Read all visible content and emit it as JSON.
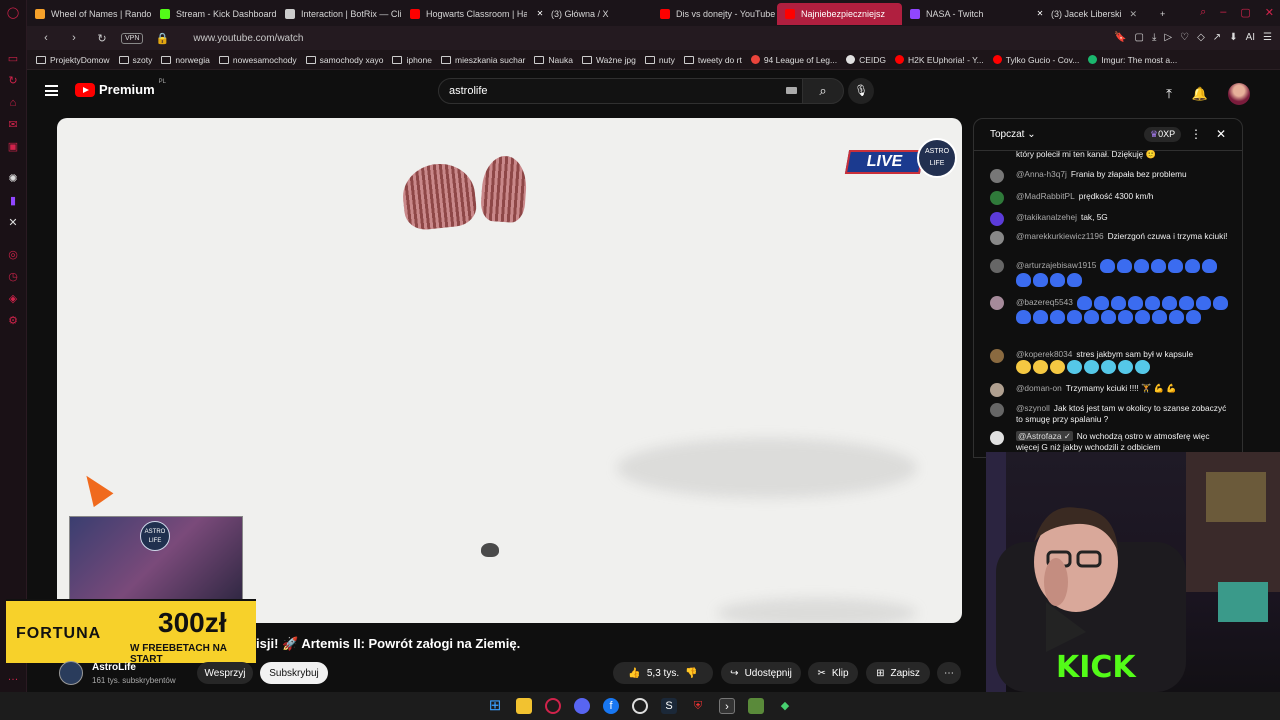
{
  "browser": {
    "tabs": [
      {
        "label": "Wheel of Names | Random",
        "color": "#f6a12a"
      },
      {
        "label": "Stream - Kick Dashboard",
        "color": "#53fc18"
      },
      {
        "label": "Interaction | BotRix — Cli",
        "color": "#cccccc"
      },
      {
        "label": "Hogwarts Classroom | Ha",
        "color": "#ff0000"
      },
      {
        "label": "(3) Główna / X",
        "color": "#ffffff"
      },
      {
        "label": "Dis vs donejty - YouTube",
        "color": "#ff0000"
      },
      {
        "label": "Najniebezpieczniejsz",
        "color": "#ff0000",
        "active": true
      },
      {
        "label": "NASA - Twitch",
        "color": "#9146ff"
      },
      {
        "label": "(3) Jacek Liberski",
        "color": "#ffffff"
      }
    ],
    "new_tab": "+",
    "window_controls": [
      "–",
      "▢",
      "✕"
    ],
    "vpn": "VPN",
    "url": "www.youtube.com/watch",
    "ai_label": "AI",
    "bookmarks": [
      {
        "label": "ProjektyDomow",
        "type": "folder"
      },
      {
        "label": "szoty",
        "type": "folder"
      },
      {
        "label": "norwegia",
        "type": "folder"
      },
      {
        "label": "nowesamochody",
        "type": "folder"
      },
      {
        "label": "samochody xayo",
        "type": "folder"
      },
      {
        "label": "iphone",
        "type": "folder"
      },
      {
        "label": "mieszkania suchar",
        "type": "folder"
      },
      {
        "label": "Nauka",
        "type": "folder"
      },
      {
        "label": "Ważne jpg",
        "type": "folder"
      },
      {
        "label": "nuty",
        "type": "folder"
      },
      {
        "label": "tweety do rt",
        "type": "folder"
      },
      {
        "label": "94 League of Leg...",
        "type": "site",
        "color": "#e9443b"
      },
      {
        "label": "CEIDG",
        "type": "site",
        "color": "#e0e0e0"
      },
      {
        "label": "H2K EUphoria! - Y...",
        "type": "site",
        "color": "#ff0000"
      },
      {
        "label": "Tylko Gucio - Cov...",
        "type": "site",
        "color": "#ff0000"
      },
      {
        "label": "Imgur: The most a...",
        "type": "site",
        "color": "#1bb76e"
      }
    ]
  },
  "youtube": {
    "logo_text": "Premium",
    "logo_region": "PL",
    "search_value": "astrolife",
    "video": {
      "live_badge": "LIVE",
      "badge_logo": "ASTRO LIFE",
      "webcam_logo": "ASTRO LIFE"
    },
    "ad": {
      "brand": "FORTUNA",
      "amount": "300zł",
      "subtitle": "W FREEBETACH NA START"
    },
    "title": "isji! 🚀 Artemis II: Powrót załogi na Ziemię.",
    "channel": {
      "name": "AstroLife",
      "subs": "161 tys. subskrybentów"
    },
    "actions": {
      "support": "Wesprzyj",
      "subscribe": "Subskrybuj",
      "likes": "5,3 tys.",
      "share": "Udostępnij",
      "clip": "Klip",
      "save": "Zapisz"
    },
    "chat": {
      "mode": "Topczat",
      "xp": "0XP",
      "messages": [
        {
          "author": "",
          "text": "który polecił mi ten kanał. Dziękuję 🙂",
          "avatar_color": "#555555"
        },
        {
          "author": "@Anna-h3q7j",
          "text": "Frania by złapała bez problemu",
          "avatar_color": "#777777"
        },
        {
          "author": "@MadRabbitPL",
          "text": "prędkość 4300 km/h",
          "avatar_color": "#2f7a3a"
        },
        {
          "author": "@takikanalzehej",
          "text": "tak, 5G",
          "avatar_color": "#5b3bd9"
        },
        {
          "author": "@marekkurkiewicz1196",
          "text": "Dzierzgoń czuwa i trzyma kciuki!",
          "avatar_color": "#888888"
        },
        {
          "author": "@arturzajebisaw1915",
          "text": "",
          "avatar_color": "#666666",
          "emotes": 11
        },
        {
          "author": "@bazereq5543",
          "text": "",
          "avatar_color": "#a58a9a",
          "emotes": 23
        },
        {
          "author": "@koperek8034",
          "text": "stres jakbym sam był w kapsule",
          "avatar_color": "#8a6a40",
          "emotes": 8
        },
        {
          "author": "@doman-on",
          "text": "Trzymamy kciuki !!!! 🏋 💪 💪",
          "avatar_color": "#b0a090"
        },
        {
          "author": "@szynoll",
          "text": "Jak ktoś jest tam w okolicy to szanse zobaczyć to smugę przy spalaniu ?",
          "avatar_color": "#666666"
        },
        {
          "author": "@Astrofaza ✓",
          "text": "No wchodzą ostro w atmosferę więc więcej G niż jakby wchodzili z odbiciem",
          "avatar_color": "#e0e0e0"
        }
      ]
    }
  },
  "taskbar": [
    "windows",
    "files",
    "browser-opera",
    "discord",
    "facebook",
    "obs",
    "steam",
    "shield",
    "terminal",
    "minecraft",
    "gem"
  ]
}
